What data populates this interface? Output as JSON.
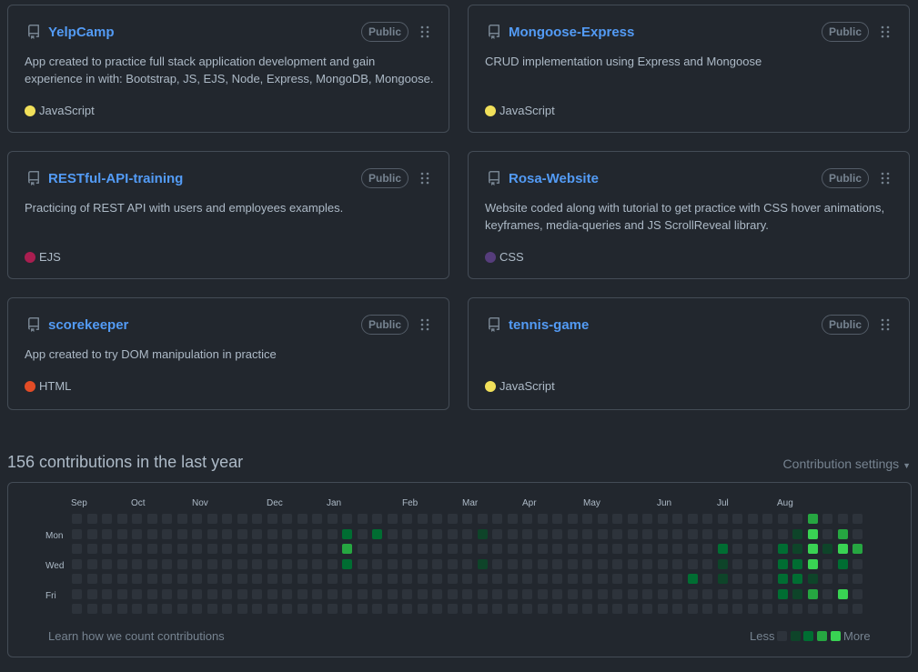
{
  "repos": [
    {
      "name": "YelpCamp",
      "visibility": "Public",
      "description": "App created to practice full stack application development and gain experience in with: Bootstrap, JS, EJS, Node, Express, MongoDB, Mongoose.",
      "language": "JavaScript",
      "language_color": "#f1e05a"
    },
    {
      "name": "Mongoose-Express",
      "visibility": "Public",
      "description": "CRUD implementation using Express and Mongoose",
      "language": "JavaScript",
      "language_color": "#f1e05a"
    },
    {
      "name": "RESTful-API-training",
      "visibility": "Public",
      "description": "Practicing of REST API with users and employees examples.",
      "language": "EJS",
      "language_color": "#a91e50"
    },
    {
      "name": "Rosa-Website",
      "visibility": "Public",
      "description": "Website coded along with tutorial to get practice with CSS hover animations, keyframes, media-queries and JS ScrollReveal library.",
      "language": "CSS",
      "language_color": "#563d7c"
    },
    {
      "name": "scorekeeper",
      "visibility": "Public",
      "description": "App created to try DOM manipulation in practice",
      "language": "HTML",
      "language_color": "#e34c26"
    },
    {
      "name": "tennis-game",
      "visibility": "Public",
      "description": "",
      "language": "JavaScript",
      "language_color": "#f1e05a"
    }
  ],
  "contributions": {
    "title": "156 contributions in the last year",
    "settings_label": "Contribution settings",
    "months": [
      "Sep",
      "Oct",
      "Nov",
      "Dec",
      "Jan",
      "Feb",
      "Mar",
      "Apr",
      "May",
      "Jun",
      "Jul",
      "Aug"
    ],
    "days": [
      "Mon",
      "Wed",
      "Fri"
    ],
    "learn_link": "Learn how we count contributions",
    "legend_less": "Less",
    "legend_more": "More",
    "level_colors": [
      "#2d333b",
      "#0e4429",
      "#006d32",
      "#26a641",
      "#39d353"
    ],
    "active_cells": [
      {
        "week": 18,
        "day": 1,
        "level": 2
      },
      {
        "week": 18,
        "day": 2,
        "level": 3
      },
      {
        "week": 18,
        "day": 3,
        "level": 2
      },
      {
        "week": 20,
        "day": 1,
        "level": 2
      },
      {
        "week": 27,
        "day": 1,
        "level": 1
      },
      {
        "week": 27,
        "day": 3,
        "level": 1
      },
      {
        "week": 41,
        "day": 4,
        "level": 2
      },
      {
        "week": 43,
        "day": 2,
        "level": 2
      },
      {
        "week": 43,
        "day": 3,
        "level": 1
      },
      {
        "week": 43,
        "day": 4,
        "level": 1
      },
      {
        "week": 47,
        "day": 2,
        "level": 2
      },
      {
        "week": 47,
        "day": 3,
        "level": 2
      },
      {
        "week": 47,
        "day": 4,
        "level": 2
      },
      {
        "week": 47,
        "day": 5,
        "level": 2
      },
      {
        "week": 48,
        "day": 1,
        "level": 1
      },
      {
        "week": 48,
        "day": 2,
        "level": 1
      },
      {
        "week": 48,
        "day": 3,
        "level": 2
      },
      {
        "week": 48,
        "day": 4,
        "level": 2
      },
      {
        "week": 48,
        "day": 5,
        "level": 1
      },
      {
        "week": 49,
        "day": 0,
        "level": 3
      },
      {
        "week": 49,
        "day": 1,
        "level": 4
      },
      {
        "week": 49,
        "day": 2,
        "level": 4
      },
      {
        "week": 49,
        "day": 3,
        "level": 4
      },
      {
        "week": 49,
        "day": 4,
        "level": 1
      },
      {
        "week": 49,
        "day": 5,
        "level": 3
      },
      {
        "week": 50,
        "day": 2,
        "level": 1
      },
      {
        "week": 51,
        "day": 1,
        "level": 3
      },
      {
        "week": 51,
        "day": 2,
        "level": 4
      },
      {
        "week": 51,
        "day": 3,
        "level": 2
      },
      {
        "week": 51,
        "day": 5,
        "level": 4
      },
      {
        "week": 52,
        "day": 2,
        "level": 3
      }
    ]
  }
}
